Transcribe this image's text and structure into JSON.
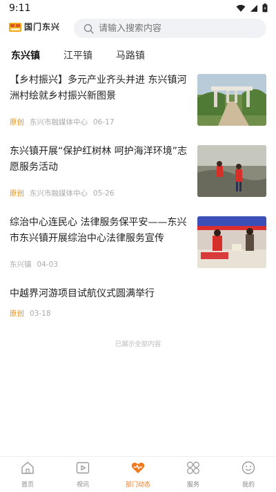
{
  "status_bar": {
    "time": "9:11"
  },
  "header": {
    "logo_text": "国门东兴",
    "search_placeholder": "请输入搜索内容"
  },
  "tabs": [
    {
      "label": "东兴镇",
      "active": true
    },
    {
      "label": "江平镇",
      "active": false
    },
    {
      "label": "马路镇",
      "active": false
    }
  ],
  "news": [
    {
      "title": "【乡村振兴】多元产业齐头并进 东兴镇河洲村绘就乡村振兴新图景",
      "tag": "原创",
      "source": "东兴市融媒体中心",
      "date": "06-17",
      "thumb": "village-gate-photo"
    },
    {
      "title": "东兴镇开展“保护红树林 呵护海洋环境”志愿服务活动",
      "tag": "原创",
      "source": "东兴市融媒体中心",
      "date": "05-26",
      "thumb": "volunteers-mangrove-photo"
    },
    {
      "title": "综治中心连民心 法律服务保平安——东兴市东兴镇开展综治中心法律服务宣传",
      "tag": "",
      "source": "东兴镇",
      "date": "04-03",
      "thumb": "legal-service-booth-photo"
    },
    {
      "title": "中越界河游项目试航仪式圆满举行",
      "tag": "原创",
      "source": "",
      "date": "03-18",
      "thumb": ""
    }
  ],
  "end_note": "已展示全部内容",
  "bottom_nav": [
    {
      "label": "首页",
      "icon": "home-icon"
    },
    {
      "label": "视讯",
      "icon": "video-icon"
    },
    {
      "label": "部门动态",
      "icon": "heart-icon",
      "active": true
    },
    {
      "label": "服务",
      "icon": "services-icon"
    },
    {
      "label": "我的",
      "icon": "profile-icon"
    }
  ],
  "colors": {
    "accent": "#f07a1f",
    "tag": "#e8900f"
  }
}
